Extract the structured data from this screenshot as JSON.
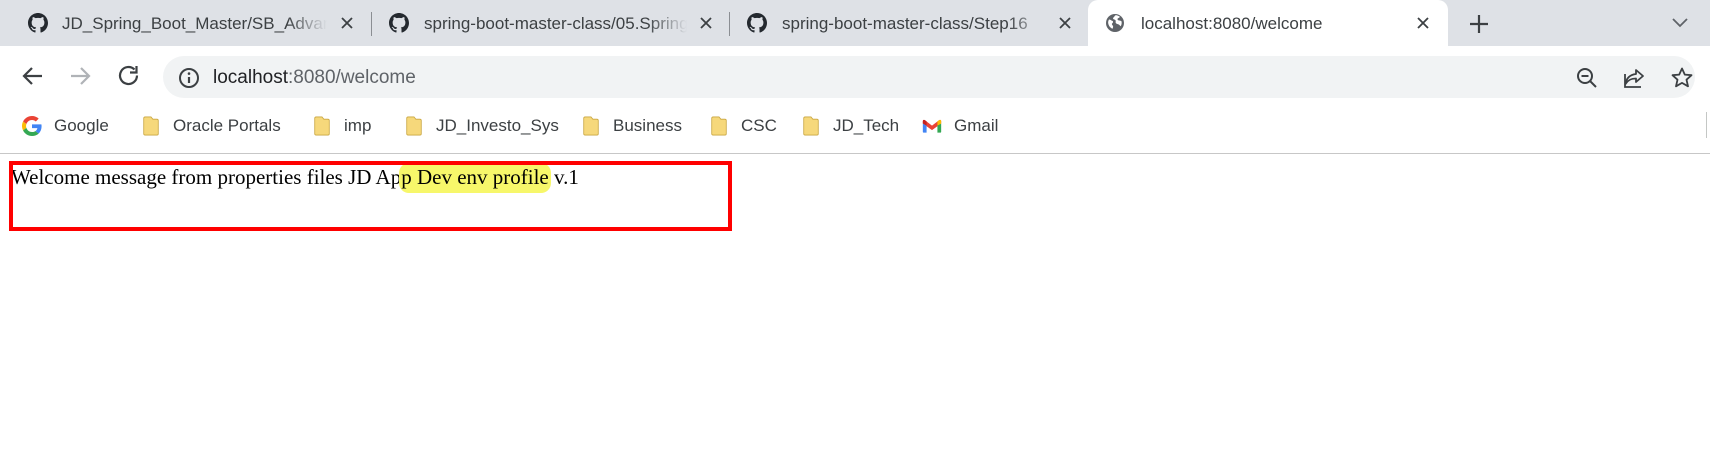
{
  "tabs": [
    {
      "title": "JD_Spring_Boot_Master/SB_Advanced",
      "favicon": "github-icon",
      "active": false
    },
    {
      "title": "spring-boot-master-class/05.Spring",
      "favicon": "github-icon",
      "active": false
    },
    {
      "title": "spring-boot-master-class/Step16",
      "favicon": "github-icon",
      "active": false
    },
    {
      "title": "localhost:8080/welcome",
      "favicon": "globe-icon",
      "active": true
    }
  ],
  "omnibox": {
    "host": "localhost",
    "rest": ":8080/welcome"
  },
  "bookmarks": [
    {
      "label": "Google",
      "icon": "google-icon"
    },
    {
      "label": "Oracle Portals",
      "icon": "folder-icon"
    },
    {
      "label": "imp",
      "icon": "folder-icon"
    },
    {
      "label": "JD_Investo_Sys",
      "icon": "folder-icon"
    },
    {
      "label": "Business",
      "icon": "folder-icon"
    },
    {
      "label": "CSC",
      "icon": "folder-icon"
    },
    {
      "label": "JD_Tech",
      "icon": "folder-icon"
    },
    {
      "label": "Gmail",
      "icon": "gmail-icon"
    }
  ],
  "page": {
    "text_before": "Welcome message from properties files JD Ap",
    "text_highlight": "p Dev env profile",
    "text_after": " v.1"
  },
  "colors": {
    "tabstrip": "#dee1e6",
    "highlight": "#f7f76a",
    "annotation": "#ff0000"
  }
}
